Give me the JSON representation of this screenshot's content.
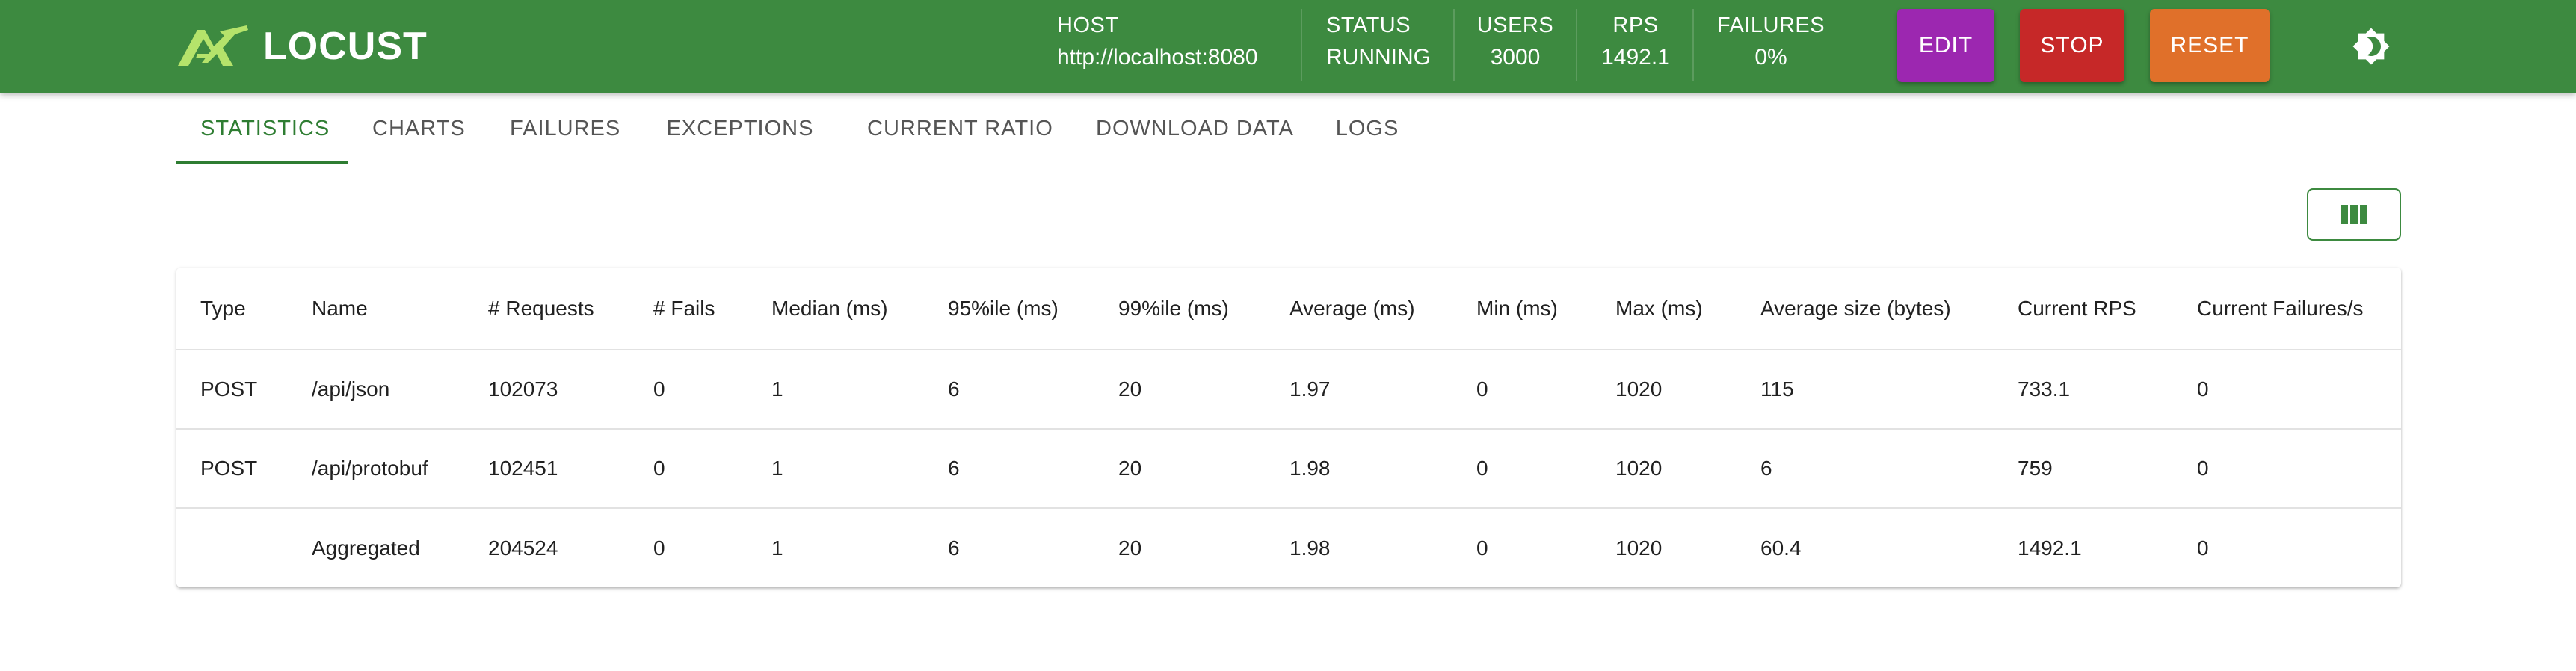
{
  "app": {
    "name": "LOCUST"
  },
  "colors": {
    "header": "#3d8a40",
    "edit": "#9c27b0",
    "stop": "#c62828",
    "reset": "#e0702a",
    "accent": "#2e7d32"
  },
  "header": {
    "host": {
      "label": "HOST",
      "value": "http://localhost:8080"
    },
    "status": {
      "label": "STATUS",
      "value": "RUNNING"
    },
    "users": {
      "label": "USERS",
      "value": "3000"
    },
    "rps": {
      "label": "RPS",
      "value": "1492.1"
    },
    "failures": {
      "label": "FAILURES",
      "value": "0%"
    },
    "buttons": {
      "edit": "EDIT",
      "stop": "STOP",
      "reset": "RESET"
    },
    "theme_icon": "brightness-icon"
  },
  "tabs": [
    {
      "label": "STATISTICS",
      "active": true
    },
    {
      "label": "CHARTS"
    },
    {
      "label": "FAILURES"
    },
    {
      "label": "EXCEPTIONS"
    },
    {
      "label": "CURRENT RATIO"
    },
    {
      "label": "DOWNLOAD DATA"
    },
    {
      "label": "LOGS"
    }
  ],
  "column_toggle_icon": "view-column-icon",
  "table": {
    "columns": [
      "Type",
      "Name",
      "# Requests",
      "# Fails",
      "Median (ms)",
      "95%ile (ms)",
      "99%ile (ms)",
      "Average (ms)",
      "Min (ms)",
      "Max (ms)",
      "Average size (bytes)",
      "Current RPS",
      "Current Failures/s"
    ],
    "rows": [
      [
        "POST",
        "/api/json",
        "102073",
        "0",
        "1",
        "6",
        "20",
        "1.97",
        "0",
        "1020",
        "115",
        "733.1",
        "0"
      ],
      [
        "POST",
        "/api/protobuf",
        "102451",
        "0",
        "1",
        "6",
        "20",
        "1.98",
        "0",
        "1020",
        "6",
        "759",
        "0"
      ],
      [
        "",
        "Aggregated",
        "204524",
        "0",
        "1",
        "6",
        "20",
        "1.98",
        "0",
        "1020",
        "60.4",
        "1492.1",
        "0"
      ]
    ]
  }
}
